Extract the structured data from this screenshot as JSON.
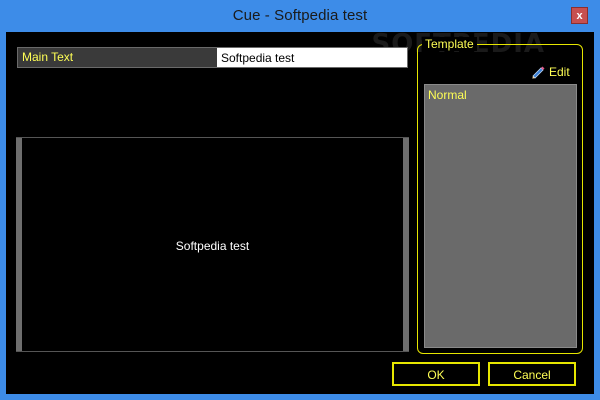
{
  "window": {
    "title": "Cue - Softpedia test",
    "watermark": "SOFTPEDIA",
    "close_label": "x",
    "accent_color": "#3d8ce8"
  },
  "main_text": {
    "label": "Main Text",
    "value": "Softpedia test"
  },
  "preview": {
    "text": "Softpedia test"
  },
  "template": {
    "legend": "Template",
    "edit_label": "Edit",
    "edit_icon": "pencil-icon",
    "items": [
      {
        "label": "Normal"
      }
    ]
  },
  "buttons": {
    "ok_label": "OK",
    "cancel_label": "Cancel"
  },
  "colors": {
    "highlight_text": "#ffff55",
    "border_yellow": "#e6e600",
    "list_background": "#6a6a6a"
  }
}
